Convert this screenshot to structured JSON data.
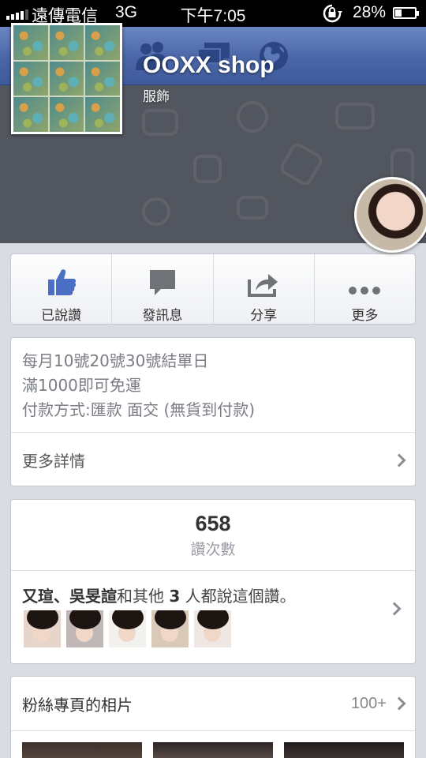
{
  "status_bar": {
    "carrier": "遠傳電信",
    "network": "3G",
    "time": "下午7:05",
    "battery": "28%",
    "icons": [
      "signal-icon",
      "rotation-lock-icon",
      "battery-charging-icon"
    ]
  },
  "nav": {
    "icons": [
      "back-arrow-icon",
      "friends-icon",
      "messages-icon",
      "globe-icon"
    ],
    "color": "#4b67a8"
  },
  "page": {
    "title": "OOXX shop",
    "category": "服飾"
  },
  "actions": [
    {
      "label": "已說讚",
      "icon": "like-thumb-icon",
      "color": "#4b6fc4"
    },
    {
      "label": "發訊息",
      "icon": "message-bubble-icon"
    },
    {
      "label": "分享",
      "icon": "share-icon"
    },
    {
      "label": "更多",
      "icon": "more-dots-icon"
    }
  ],
  "about": {
    "lines": [
      "每月10號20號30號結單日",
      "滿1000即可免運",
      "付款方式:匯款 面交 (無貨到付款)"
    ],
    "more_label": "更多詳情"
  },
  "likes": {
    "count": "658",
    "count_label": "讚次數",
    "friends": {
      "names": "又瑄、吳旻諠",
      "and": "和其他",
      "others": "3",
      "suffix": "人都說這個讚。"
    }
  },
  "photos": {
    "title": "粉絲專頁的相片",
    "count": "100+"
  }
}
